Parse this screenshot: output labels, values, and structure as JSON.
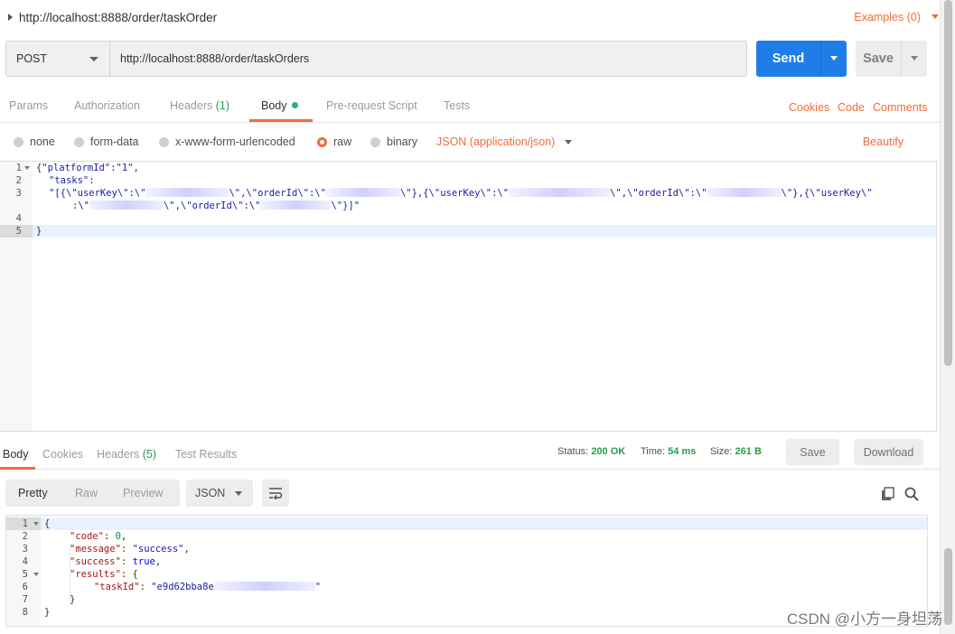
{
  "title": "http://localhost:8888/order/taskOrder",
  "examples_label": "Examples (0)",
  "request": {
    "method": "POST",
    "url": "http://localhost:8888/order/taskOrders",
    "send_label": "Send",
    "save_label": "Save"
  },
  "req_tabs": {
    "params": "Params",
    "authorization": "Authorization",
    "headers": "Headers",
    "headers_count": "(1)",
    "body": "Body",
    "prerequest": "Pre-request Script",
    "tests": "Tests"
  },
  "right_links": {
    "cookies": "Cookies",
    "code": "Code",
    "comments": "Comments"
  },
  "body_types": {
    "none": "none",
    "form_data": "form-data",
    "urlencoded": "x-www-form-urlencoded",
    "raw": "raw",
    "binary": "binary",
    "content_type": "JSON (application/json)",
    "beautify": "Beautify"
  },
  "request_body": {
    "line_numbers": [
      "1",
      "2",
      "3",
      "",
      "4",
      "5"
    ],
    "l1a": "{",
    "l1b": "\"platformId\":\"1\",",
    "l2": "\"tasks\":",
    "l3a": "\"[{\\\"userKey\\\":\\\"",
    "l3b": "\\\",\\\"orderId\\\":\\\"",
    "l3c": "\\\"},{\\\"userKey\\\":\\\"",
    "l3d": "\\\",\\\"orderId\\\":\\\"",
    "l3e": "\\\"},{\\\"userKey\\\"",
    "l3f": ":\\\"",
    "l3g": "\\\",\\\"orderId\\\":\\\"",
    "l3h": "\\\"}]\"",
    "l5": "}"
  },
  "resp_tabs": {
    "body": "Body",
    "cookies": "Cookies",
    "headers": "Headers",
    "headers_count": "(5)",
    "test_results": "Test Results"
  },
  "status": {
    "status_label": "Status:",
    "status_value": "200 OK",
    "time_label": "Time:",
    "time_value": "54 ms",
    "size_label": "Size:",
    "size_value": "261 B",
    "save_label": "Save",
    "download_label": "Download"
  },
  "view": {
    "pretty": "Pretty",
    "raw": "Raw",
    "preview": "Preview",
    "format": "JSON"
  },
  "response_body": {
    "line_numbers": [
      "1",
      "2",
      "3",
      "4",
      "5",
      "6",
      "7",
      "8"
    ],
    "l1": "{",
    "code_key": "\"code\"",
    "code_val": "0",
    "message_key": "\"message\"",
    "message_val": "\"success\"",
    "success_key": "\"success\"",
    "success_val": "true",
    "results_key": "\"results\"",
    "taskid_key": "\"taskId\"",
    "taskid_val_start": "\"e9d62bba8e",
    "taskid_val_end": "\"",
    "l7": "}",
    "l8": "}"
  },
  "watermark": "CSDN @小方一身坦荡",
  "colors": {
    "accent": "#f26b3a",
    "primary": "#1f7de8",
    "status_ok": "#22a04b"
  }
}
